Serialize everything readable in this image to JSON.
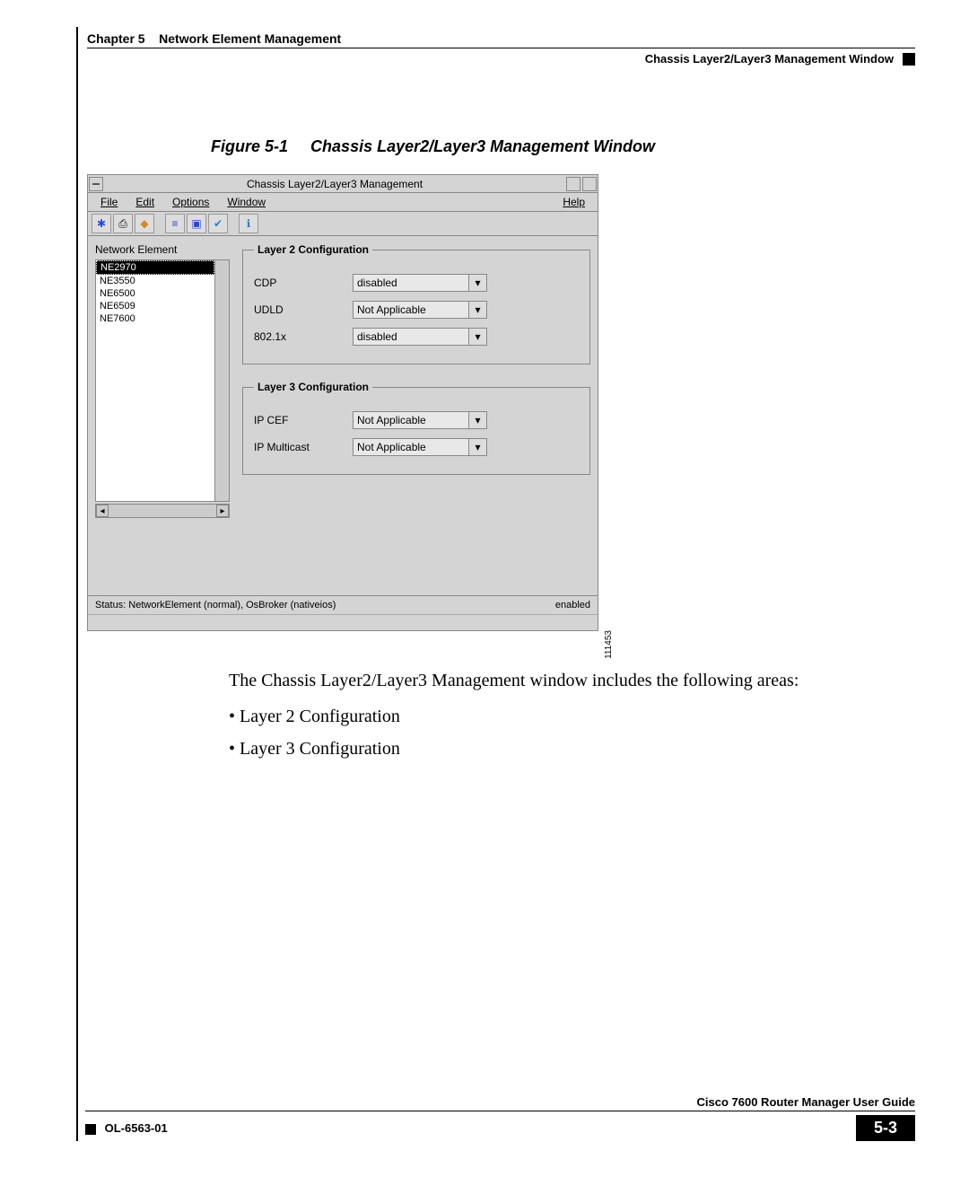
{
  "header": {
    "chapter": "Chapter 5",
    "title": "Network Element Management",
    "subtitle": "Chassis Layer2/Layer3 Management Window"
  },
  "figure": {
    "label": "Figure 5-1",
    "title": "Chassis Layer2/Layer3 Management Window",
    "id": "111453"
  },
  "window": {
    "title": "Chassis Layer2/Layer3 Management",
    "menus": {
      "file": "File",
      "edit": "Edit",
      "options": "Options",
      "window": "Window",
      "help": "Help"
    },
    "ne_label": "Network Element",
    "ne_items": [
      "NE2970",
      "NE3550",
      "NE6500",
      "NE6509",
      "NE7600"
    ],
    "layer2": {
      "legend": "Layer 2 Configuration",
      "cdp_label": "CDP",
      "cdp_value": "disabled",
      "udld_label": "UDLD",
      "udld_value": "Not Applicable",
      "dot1x_label": "802.1x",
      "dot1x_value": "disabled"
    },
    "layer3": {
      "legend": "Layer 3 Configuration",
      "ipcef_label": "IP CEF",
      "ipcef_value": "Not Applicable",
      "ipmc_label": "IP Multicast",
      "ipmc_value": "Not Applicable"
    },
    "status_left": "Status: NetworkElement (normal), OsBroker (nativeios)",
    "status_right": "enabled"
  },
  "body": {
    "intro": "The Chassis Layer2/Layer3 Management window includes the following areas:",
    "b1": "Layer 2 Configuration",
    "b2": "Layer 3 Configuration"
  },
  "footer": {
    "guide": "Cisco 7600 Router Manager User Guide",
    "ol": "OL-6563-01",
    "page": "5-3"
  }
}
